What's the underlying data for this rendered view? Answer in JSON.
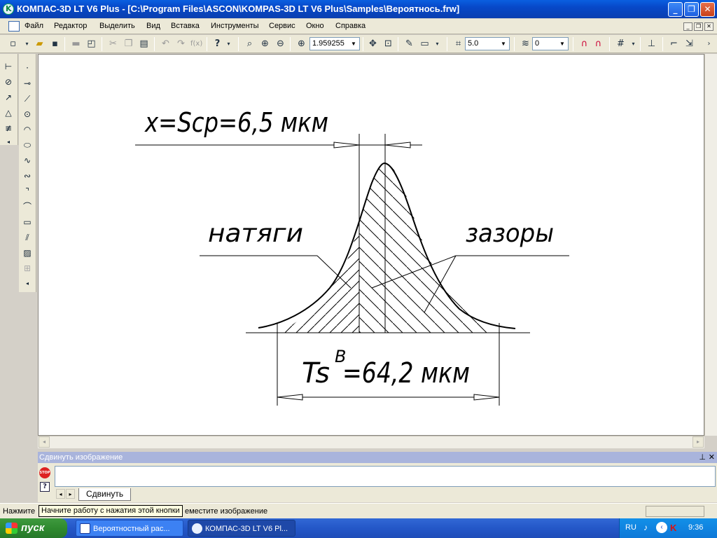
{
  "window": {
    "title": "КОМПАС-3D LT V6 Plus - [C:\\Program Files\\ASCON\\KOMPAS-3D LT V6 Plus\\Samples\\Вероятнось.frw]",
    "minimize_label": "_",
    "maximize_label": "❐",
    "close_label": "✕"
  },
  "menu": {
    "items": [
      "Файл",
      "Редактор",
      "Выделить",
      "Вид",
      "Вставка",
      "Инструменты",
      "Сервис",
      "Окно",
      "Справка"
    ]
  },
  "toolbar": {
    "zoom_value": "1.959255",
    "step_value": "5.0",
    "layer_value": "0",
    "help_label": "?"
  },
  "drawing": {
    "top_label": "x=Scp=6,5 мкм",
    "left_label": "натяги",
    "right_label": "зазоры",
    "bottom_label_main": "Ts",
    "bottom_label_sup": "B",
    "bottom_label_rest": "=64,2 мкм"
  },
  "command_panel": {
    "header": "Сдвинуть изображение",
    "tab_label": "Сдвинуть",
    "pin_label": "⊥",
    "close_label": "✕"
  },
  "status_bar": {
    "left_text": "Нажмите",
    "tooltip": "Начните работу с нажатия этой кнопки",
    "right_text": "еместите изображение"
  },
  "taskbar": {
    "start_label": "пуск",
    "tasks": [
      "Вероятностный рас...",
      "КОМПАС-3D LT V6 Pl..."
    ],
    "lang": "RU",
    "clock": "9:36"
  },
  "colors": {
    "titlebar": "#0a5fe0",
    "taskbar": "#2457c8",
    "start": "#2f8a2f",
    "command_header": "#a9b4dc"
  }
}
